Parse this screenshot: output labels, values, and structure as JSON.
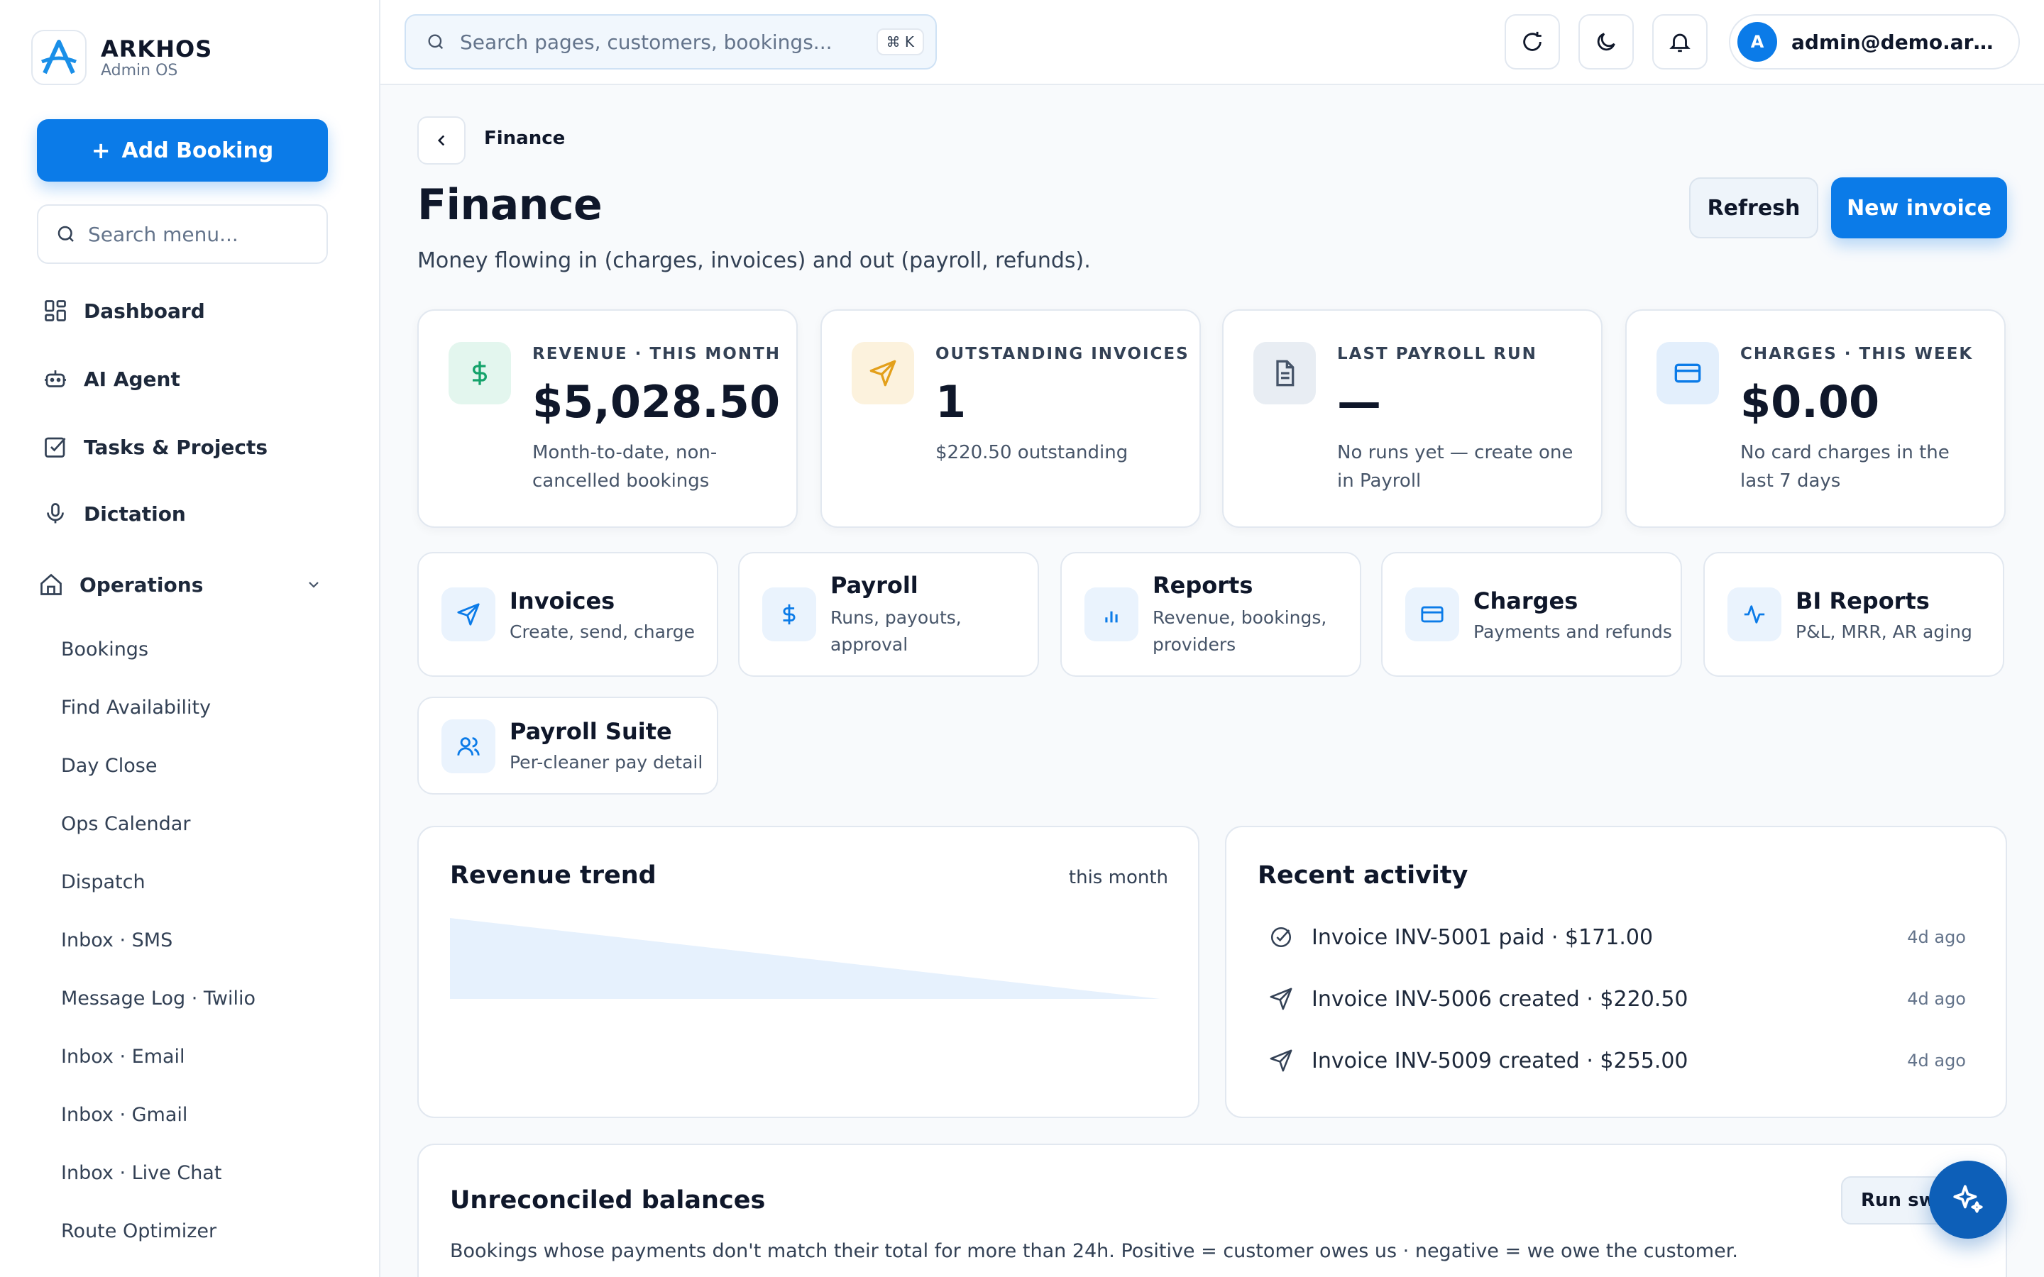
{
  "brand": {
    "name": "ARKHOS",
    "subtitle": "Admin OS"
  },
  "sidebar": {
    "add_booking_label": "Add Booking",
    "search_placeholder": "Search menu...",
    "items": [
      {
        "label": "Dashboard",
        "icon": "dashboard-icon"
      },
      {
        "label": "AI Agent",
        "icon": "robot-icon"
      },
      {
        "label": "Tasks & Projects",
        "icon": "checkbox-icon"
      },
      {
        "label": "Dictation",
        "icon": "microphone-icon"
      }
    ],
    "group": {
      "label": "Operations",
      "icon": "home-icon",
      "items": [
        "Bookings",
        "Find Availability",
        "Day Close",
        "Ops Calendar",
        "Dispatch",
        "Inbox · SMS",
        "Message Log · Twilio",
        "Inbox · Email",
        "Inbox · Gmail",
        "Inbox · Live Chat",
        "Route Optimizer"
      ]
    }
  },
  "topbar": {
    "search_placeholder": "Search pages, customers, bookings...",
    "shortcut": "⌘ K",
    "user_initial": "A",
    "user_email": "admin@demo.arkhos.ai"
  },
  "page": {
    "breadcrumb": "Finance",
    "title": "Finance",
    "subtitle": "Money flowing in (charges, invoices) and out (payroll, refunds).",
    "refresh_label": "Refresh",
    "new_invoice_label": "New invoice"
  },
  "stats": [
    {
      "label": "REVENUE · THIS MONTH",
      "value": "$5,028.50",
      "note": "Month-to-date, non-cancelled bookings",
      "icon": "dollar-icon",
      "color": "#15a36b",
      "bg": "#e3f6ee"
    },
    {
      "label": "OUTSTANDING INVOICES",
      "value": "1",
      "note": "$220.50 outstanding",
      "icon": "send-icon",
      "color": "#e3a01b",
      "bg": "#fcf2dd"
    },
    {
      "label": "LAST PAYROLL RUN",
      "value": "—",
      "note": "No runs yet — create one in Payroll",
      "icon": "document-icon",
      "color": "#475569",
      "bg": "#e8edf3"
    },
    {
      "label": "CHARGES · THIS WEEK",
      "value": "$0.00",
      "note": "No card charges in the last 7 days",
      "icon": "credit-card-icon",
      "color": "#0b7be8",
      "bg": "#e3effc"
    }
  ],
  "quick_links": [
    {
      "title": "Invoices",
      "desc": "Create, send, charge",
      "icon": "send-icon"
    },
    {
      "title": "Payroll",
      "desc": "Runs, payouts, approval",
      "icon": "dollar-icon"
    },
    {
      "title": "Reports",
      "desc": "Revenue, bookings, providers",
      "icon": "bar-chart-icon"
    },
    {
      "title": "Charges",
      "desc": "Payments and refunds",
      "icon": "credit-card-icon"
    },
    {
      "title": "BI Reports",
      "desc": "P&L, MRR, AR aging",
      "icon": "pulse-icon"
    },
    {
      "title": "Payroll Suite",
      "desc": "Per-cleaner pay detail",
      "icon": "users-icon"
    }
  ],
  "revenue_trend": {
    "title": "Revenue trend",
    "period": "this month"
  },
  "activity": {
    "title": "Recent activity",
    "items": [
      {
        "text": "Invoice INV-5001 paid · $171.00",
        "ago": "4d ago",
        "icon": "check-circle-icon"
      },
      {
        "text": "Invoice INV-5006 created · $220.50",
        "ago": "4d ago",
        "icon": "send-icon"
      },
      {
        "text": "Invoice INV-5009 created · $255.00",
        "ago": "4d ago",
        "icon": "send-icon"
      }
    ]
  },
  "balances": {
    "title": "Unreconciled balances",
    "description": "Bookings whose payments don't match their total for more than 24h. Positive = customer owes us · negative = we owe the customer.",
    "run_label": "Run sweep"
  },
  "colors": {
    "accent": "#0b7be8",
    "fab": "#0d5fb8"
  }
}
